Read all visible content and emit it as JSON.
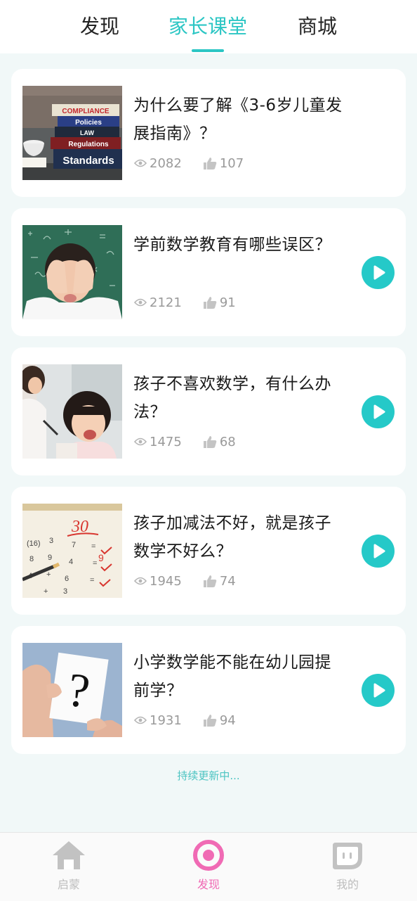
{
  "tabs": [
    {
      "label": "发现",
      "active": false
    },
    {
      "label": "家长课堂",
      "active": true
    },
    {
      "label": "商城",
      "active": false
    }
  ],
  "articles": [
    {
      "title": "为什么要了解《3-6岁儿童发展指南》？",
      "views": "2082",
      "likes": "107",
      "has_play": false,
      "image": "books-compliance-standards"
    },
    {
      "title": "学前数学教育有哪些误区？",
      "views": "2121",
      "likes": "91",
      "has_play": true,
      "image": "child-covering-face"
    },
    {
      "title": "孩子不喜欢数学，有什么办法？",
      "views": "1475",
      "likes": "68",
      "has_play": true,
      "image": "girl-laughing-with-mother"
    },
    {
      "title": "孩子加减法不好，就是孩子数学不好么？",
      "views": "1945",
      "likes": "74",
      "has_play": true,
      "image": "math-worksheet-score-30"
    },
    {
      "title": "小学数学能不能在幼儿园提前学？",
      "views": "1931",
      "likes": "94",
      "has_play": true,
      "image": "hand-holding-question-mark"
    }
  ],
  "book_labels": [
    "COMPLIANCE",
    "Policies",
    "LAW",
    "Regulations",
    "Standards"
  ],
  "worksheet_score": "30",
  "question_mark": "?",
  "footer_note": "持续更新中...",
  "bottom_nav": [
    {
      "label": "启蒙",
      "icon": "home-icon",
      "active": false
    },
    {
      "label": "发现",
      "icon": "discover-ring-icon",
      "active": true
    },
    {
      "label": "我的",
      "icon": "profile-face-icon",
      "active": false
    }
  ],
  "colors": {
    "accent": "#2cc6c4",
    "nav_active": "#f06ab4",
    "nav_inactive": "#bdbdbd"
  }
}
